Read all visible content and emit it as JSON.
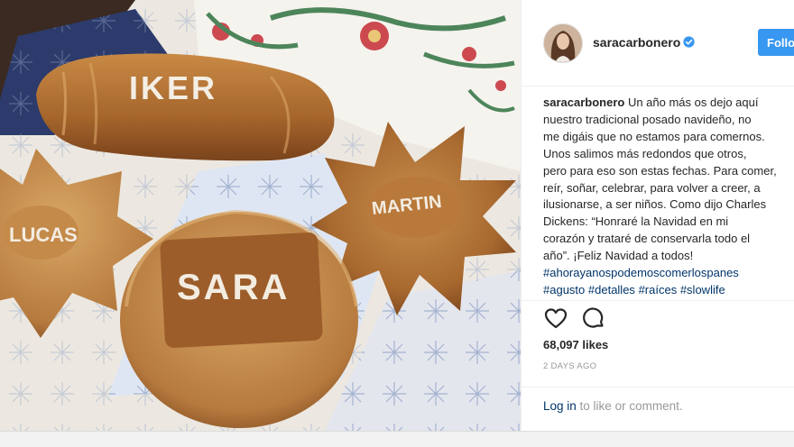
{
  "post": {
    "username": "saracarbonero",
    "follow_label": "Follow",
    "caption_user": "saracarbonero",
    "caption_lines": [
      " Un año más os dejo aquí",
      "nuestro tradicional posado navideño, no",
      "me digáis que no estamos para comernos.",
      "Unos salimos más redondos que otros,",
      "pero para eso son estas fechas. Para comer,",
      "reír, soñar, celebrar, para volver a creer, a",
      "ilusionarse, a ser niños. Como dijo Charles",
      "Dickens: “Honraré la Navidad en mi",
      "corazón y trataré de conservarla todo el",
      "año”. ¡Feliz Navidad a todos!"
    ],
    "hashtags_line1": [
      "#ahorayanospodemoscomerlospanes"
    ],
    "hashtags_line2": [
      "#agusto",
      "#detalles",
      "#raíces",
      "#slowlife"
    ],
    "likes": "68,097 likes",
    "date": "2 DAYS AGO",
    "login_link": "Log in",
    "login_rest": " to like or comment."
  },
  "photo": {
    "bread_names": [
      "IKER",
      "LUCAS",
      "SARA",
      "MARTIN"
    ]
  },
  "colors": {
    "follow_blue": "#3897f0",
    "verified_blue": "#3897f0",
    "hashtag": "#003569",
    "muted": "#999999",
    "text": "#262626"
  },
  "icons": [
    "verified-icon",
    "heart-icon",
    "comment-icon"
  ]
}
